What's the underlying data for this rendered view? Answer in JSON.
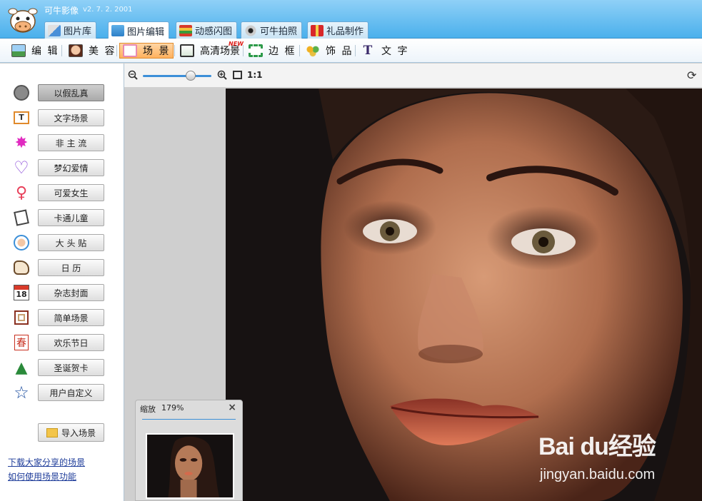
{
  "app": {
    "title": "可牛影像",
    "version": "v2. 7. 2. 2001"
  },
  "main_tabs": [
    {
      "label": "图片库"
    },
    {
      "label": "图片编辑"
    },
    {
      "label": "动感闪图"
    },
    {
      "label": "可牛拍照"
    },
    {
      "label": "礼品制作"
    }
  ],
  "tools": [
    {
      "label": "编 辑"
    },
    {
      "label": "美 容"
    },
    {
      "label": "场 景"
    },
    {
      "label": "高清场景"
    },
    {
      "label": "边 框"
    },
    {
      "label": "饰 品"
    },
    {
      "label": "文 字"
    }
  ],
  "new_badge": "NEW",
  "scenes": [
    {
      "label": "以假乱真",
      "icon": "mask-icon"
    },
    {
      "label": "文字场景",
      "icon": "text-scene-icon"
    },
    {
      "label": "非 主 流",
      "icon": "sparkle-icon"
    },
    {
      "label": "梦幻爱情",
      "icon": "heart-icon"
    },
    {
      "label": "可爱女生",
      "icon": "female-icon"
    },
    {
      "label": "卡通儿童",
      "icon": "book-icon"
    },
    {
      "label": "大 头 贴",
      "icon": "photo-sticker-icon"
    },
    {
      "label": "日   历",
      "icon": "dog-icon"
    },
    {
      "label": "杂志封面",
      "icon": "calendar-icon"
    },
    {
      "label": "简单场景",
      "icon": "frame-icon"
    },
    {
      "label": "欢乐节日",
      "icon": "spring-festival-icon"
    },
    {
      "label": "圣诞贺卡",
      "icon": "christmas-tree-icon"
    },
    {
      "label": "用户自定义",
      "icon": "star-icon"
    }
  ],
  "calendar_day": "18",
  "spring_char": "春",
  "import_label": "导入场景",
  "links": {
    "download": "下载大家分享的场景",
    "howto": "如何使用场景功能"
  },
  "zoom": {
    "actual_size_label": "1:1",
    "level": 0.7
  },
  "navigator": {
    "title": "缩放",
    "zoom": "179%",
    "close": "×"
  },
  "watermark": {
    "brand": "Bai du经验",
    "url": "jingyan.baidu.com"
  },
  "colors": {
    "accent": "#3c8fd8",
    "active_tool": "#ffb25e",
    "link": "#1f3d9a"
  }
}
